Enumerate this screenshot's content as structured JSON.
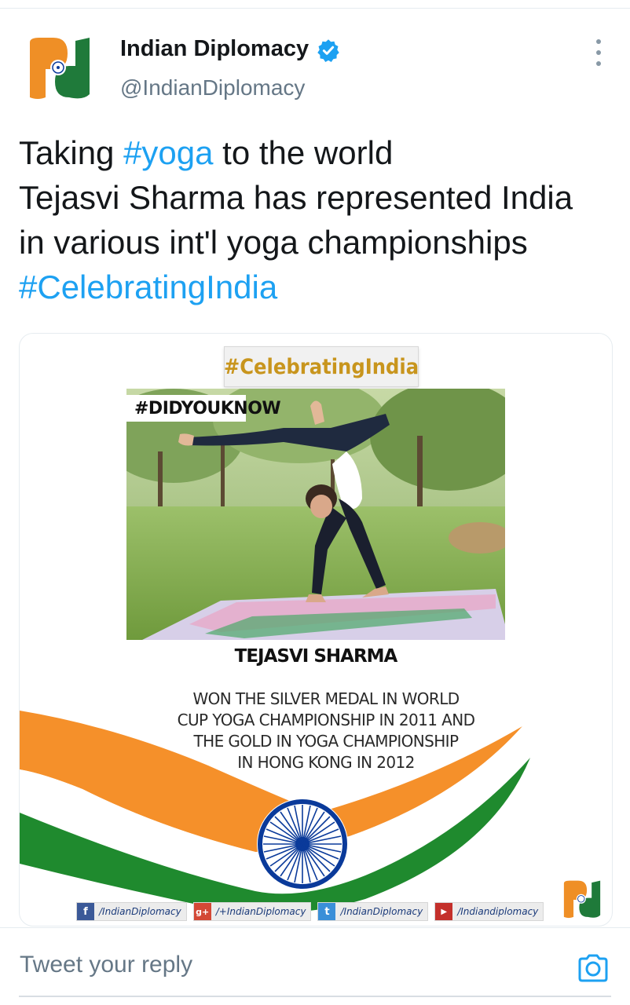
{
  "tweet": {
    "author_name": "Indian Diplomacy",
    "author_handle": "@IndianDiplomacy",
    "text_part1": "Taking ",
    "hashtag_yoga": "#yoga",
    "text_part2": " to the world",
    "line2": "Tejasvi Sharma has represented India",
    "line3": "in various int'l yoga championships",
    "hashtag_celebrating": "#CelebratingIndia"
  },
  "media": {
    "banner": "#CelebratingIndia",
    "did_you_know": "#DIDYOUKNOW",
    "person_name": "TEJASVI SHARMA",
    "fact_lines": [
      "WON THE SILVER MEDAL IN WORLD",
      "CUP YOGA CHAMPIONSHIP IN 2011 AND",
      "THE GOLD IN YOGA CHAMPIONSHIP",
      "IN HONG KONG IN 2012"
    ],
    "social": [
      {
        "icon": "facebook-icon",
        "label": "/IndianDiplomacy",
        "color": "#3b5998"
      },
      {
        "icon": "google-plus-icon",
        "label": "/+IndianDiplomacy",
        "color": "#d34836"
      },
      {
        "icon": "twitter-icon",
        "label": "/IndianDiplomacy",
        "color": "#3a8fd8"
      },
      {
        "icon": "youtube-icon",
        "label": "/Indiandiplomacy",
        "color": "#c4302b"
      }
    ]
  },
  "reply": {
    "placeholder": "Tweet your reply"
  },
  "colors": {
    "link": "#1da1f2",
    "saffron": "#ff9933",
    "green": "#138808",
    "chakra": "#0a3a9a",
    "gold_text": "#c8951d"
  }
}
